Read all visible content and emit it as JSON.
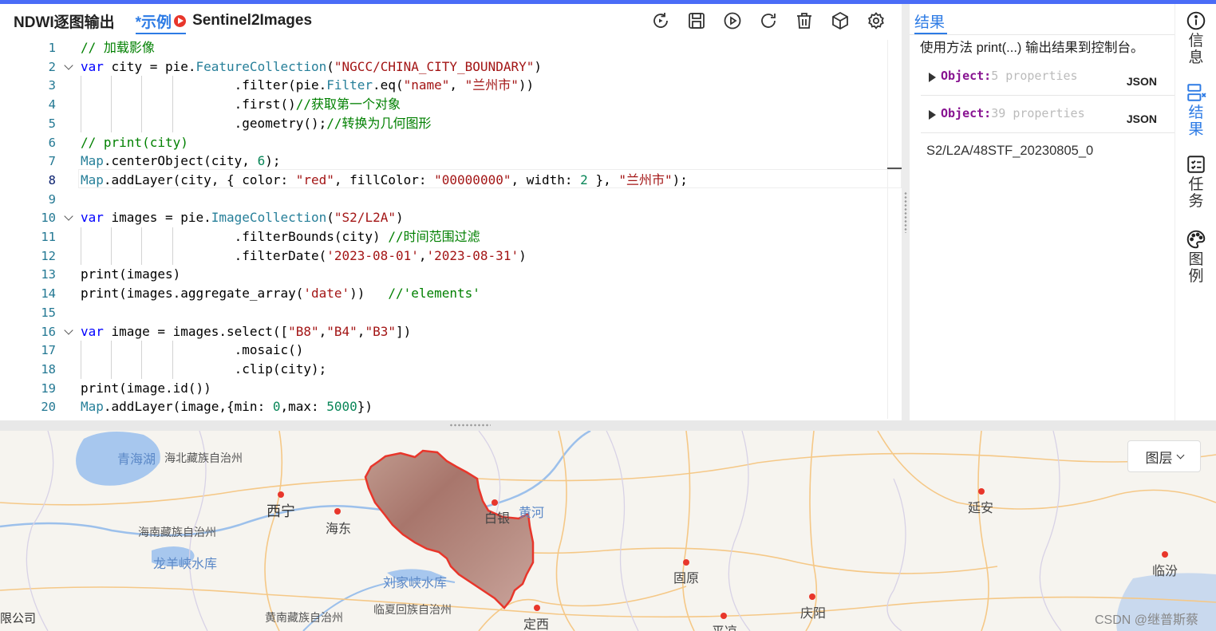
{
  "editor": {
    "title": "NDWI逐图输出",
    "tab_label": "*示例",
    "script_name": "Sentinel2Images",
    "toolbar": [
      "refresh-icon",
      "save-icon",
      "run-icon",
      "reload-icon",
      "delete-icon",
      "package-icon",
      "settings-icon"
    ],
    "lines": [
      {
        "n": "1",
        "fold": false,
        "tokens": [
          [
            "c-com",
            "// 加载影像"
          ]
        ]
      },
      {
        "n": "2",
        "fold": true,
        "tokens": [
          [
            "c-kw",
            "var"
          ],
          [
            "",
            " city = pie."
          ],
          [
            "c-ty",
            "FeatureCollection"
          ],
          [
            "",
            "("
          ],
          [
            "c-str",
            "\"NGCC/CHINA_CITY_BOUNDARY\""
          ],
          [
            "",
            ")"
          ]
        ]
      },
      {
        "n": "3",
        "fold": false,
        "tokens": [
          [
            "",
            "                    .filter(pie."
          ],
          [
            "c-ty",
            "Filter"
          ],
          [
            "",
            ".eq("
          ],
          [
            "c-str",
            "\"name\""
          ],
          [
            "",
            ", "
          ],
          [
            "c-str",
            "\"兰州市\""
          ],
          [
            "",
            "))"
          ]
        ]
      },
      {
        "n": "4",
        "fold": false,
        "tokens": [
          [
            "",
            "                    .first()"
          ],
          [
            "c-com",
            "//获取第一个对象"
          ]
        ]
      },
      {
        "n": "5",
        "fold": false,
        "tokens": [
          [
            "",
            "                    .geometry();"
          ],
          [
            "c-com",
            "//转换为几何图形"
          ]
        ]
      },
      {
        "n": "6",
        "fold": false,
        "tokens": [
          [
            "c-com",
            "// print(city)"
          ]
        ]
      },
      {
        "n": "7",
        "fold": false,
        "tokens": [
          [
            "c-ty",
            "Map"
          ],
          [
            "",
            ".centerObject(city, "
          ],
          [
            "c-num",
            "6"
          ],
          [
            "",
            ");"
          ]
        ]
      },
      {
        "n": "8",
        "fold": false,
        "tokens": [
          [
            "c-ty",
            "Map"
          ],
          [
            "",
            ".addLayer(city, { color: "
          ],
          [
            "c-str",
            "\"red\""
          ],
          [
            "",
            ", fillColor: "
          ],
          [
            "c-str",
            "\"00000000\""
          ],
          [
            "",
            ", width: "
          ],
          [
            "c-num",
            "2"
          ],
          [
            "",
            " }, "
          ],
          [
            "c-str",
            "\"兰州市\""
          ],
          [
            "",
            ");"
          ]
        ]
      },
      {
        "n": "9",
        "fold": false,
        "tokens": []
      },
      {
        "n": "10",
        "fold": true,
        "tokens": [
          [
            "c-kw",
            "var"
          ],
          [
            "",
            " images = pie."
          ],
          [
            "c-ty",
            "ImageCollection"
          ],
          [
            "",
            "("
          ],
          [
            "c-str",
            "\"S2/L2A\""
          ],
          [
            "",
            ")"
          ]
        ]
      },
      {
        "n": "11",
        "fold": false,
        "tokens": [
          [
            "",
            "                    .filterBounds(city) "
          ],
          [
            "c-com",
            "//时间范围过滤"
          ]
        ]
      },
      {
        "n": "12",
        "fold": false,
        "tokens": [
          [
            "",
            "                    .filterDate("
          ],
          [
            "c-str",
            "'2023-08-01'"
          ],
          [
            "",
            ","
          ],
          [
            "c-str",
            "'2023-08-31'"
          ],
          [
            "",
            ")"
          ]
        ]
      },
      {
        "n": "13",
        "fold": false,
        "tokens": [
          [
            "",
            "print(images)"
          ]
        ]
      },
      {
        "n": "14",
        "fold": false,
        "tokens": [
          [
            "",
            "print(images.aggregate_array("
          ],
          [
            "c-str",
            "'date'"
          ],
          [
            "",
            "))   "
          ],
          [
            "c-com",
            "//'elements'"
          ]
        ]
      },
      {
        "n": "15",
        "fold": false,
        "tokens": []
      },
      {
        "n": "16",
        "fold": true,
        "tokens": [
          [
            "c-kw",
            "var"
          ],
          [
            "",
            " image = images.select(["
          ],
          [
            "c-str",
            "\"B8\""
          ],
          [
            "",
            ","
          ],
          [
            "c-str",
            "\"B4\""
          ],
          [
            "",
            ","
          ],
          [
            "c-str",
            "\"B3\""
          ],
          [
            "",
            "])"
          ]
        ]
      },
      {
        "n": "17",
        "fold": false,
        "tokens": [
          [
            "",
            "                    .mosaic()"
          ]
        ]
      },
      {
        "n": "18",
        "fold": false,
        "tokens": [
          [
            "",
            "                    .clip(city);"
          ]
        ]
      },
      {
        "n": "19",
        "fold": false,
        "tokens": [
          [
            "",
            "print(image.id())"
          ]
        ]
      },
      {
        "n": "20",
        "fold": false,
        "tokens": [
          [
            "c-ty",
            "Map"
          ],
          [
            "",
            ".addLayer(image,{min: "
          ],
          [
            "c-num",
            "0"
          ],
          [
            "",
            ",max: "
          ],
          [
            "c-num",
            "5000"
          ],
          [
            "",
            "})"
          ]
        ]
      }
    ]
  },
  "results": {
    "tab_label": "结果",
    "hint": "使用方法 print(...) 输出结果到控制台。",
    "rows": [
      {
        "label": "Object:",
        "count": "5",
        "suffix": "properties",
        "json": "JSON"
      },
      {
        "label": "Object:",
        "count": "39",
        "suffix": "properties",
        "json": "JSON"
      }
    ],
    "image_id": "S2/L2A/48STF_20230805_0"
  },
  "rail": [
    {
      "icon": "info-icon",
      "label": "信息"
    },
    {
      "icon": "results-icon",
      "label": "结果",
      "active": true
    },
    {
      "icon": "tasks-icon",
      "label": "任务"
    },
    {
      "icon": "legend-icon",
      "label": "图例"
    }
  ],
  "map": {
    "layer_button": "图层",
    "watermark": "CSDN @继普斯蔡",
    "corner_text": "限公司",
    "labels": {
      "qinghaihu": "青海湖",
      "haibei": "海北藏族自治州",
      "xining": "西宁",
      "haidong": "海东",
      "hainan": "海南藏族自治州",
      "longyangxia": "龙羊峡水库",
      "liujiaxia": "刘家峡水库",
      "linxia": "临夏回族自治州",
      "huangnan": "黄南藏族自治州",
      "baiyin": "白银",
      "huanghe": "黄河",
      "guyuan": "固原",
      "dingxi": "定西",
      "pingliang": "平凉",
      "qingyang": "庆阳",
      "yanan": "延安",
      "linfen": "临汾"
    },
    "colors": {
      "water": "#a7c7ee",
      "road": "#f5c887",
      "boundary": "#e8362b",
      "marker": "#e8362b"
    }
  }
}
